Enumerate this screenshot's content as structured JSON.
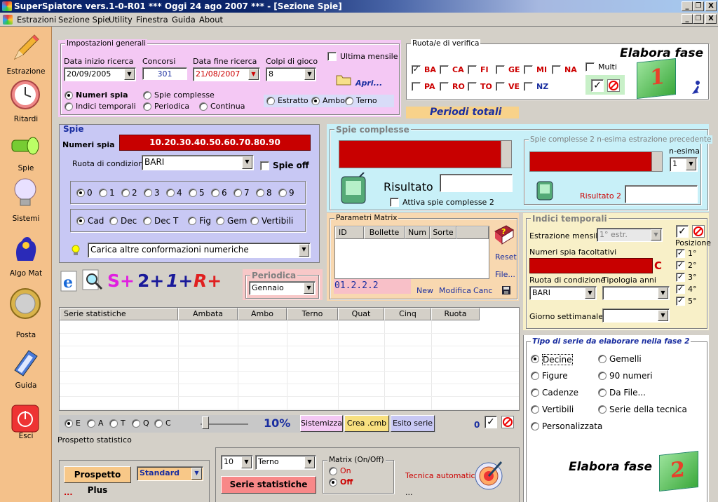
{
  "window": {
    "title": "SuperSpiatore vers.1-0-R01  ***  Oggi 24 ago 2007  ***  - [Sezione Spie]",
    "min": "_",
    "restore": "❐",
    "close": "X"
  },
  "menu": [
    "Estrazioni",
    "Sezione Spie",
    "Utility",
    "Finestra",
    "Guida",
    "About"
  ],
  "sidebar": [
    {
      "label": "Estrazione",
      "icon": "pencil-icon"
    },
    {
      "label": "Ritardi",
      "icon": "clock-icon"
    },
    {
      "label": "Spie",
      "icon": "flashlight-icon"
    },
    {
      "label": "Sistemi",
      "icon": "lightbulb-icon"
    },
    {
      "label": "Algo Mat",
      "icon": "lottery-hand-icon"
    },
    {
      "label": "Posta",
      "icon": "coin-icon"
    },
    {
      "label": "Guida",
      "icon": "book-icon"
    },
    {
      "label": "Esci",
      "icon": "power-icon"
    }
  ],
  "impostazioni": {
    "title": "Impostazioni generali",
    "data_inizio_label": "Data inizio ricerca",
    "data_inizio": "20/09/2005",
    "concorsi_label": "Concorsi",
    "concorsi": "301",
    "data_fine_label": "Data fine ricerca",
    "data_fine": "21/08/2007",
    "colpi_label": "Colpi di gioco",
    "colpi": "8",
    "ultima_mensile": "Ultima mensile",
    "apri": "Apri...",
    "modes": [
      "Numeri spia",
      "Spie complesse",
      "Indici temporali",
      "Periodica",
      "Continua"
    ],
    "sorte": [
      "Estratto",
      "Ambo",
      "Terno"
    ]
  },
  "ruote": {
    "title": "Ruota/e di verifica",
    "row1": [
      "BA",
      "CA",
      "FI",
      "GE",
      "MI",
      "NA"
    ],
    "row2": [
      "PA",
      "RO",
      "TO",
      "VE",
      "NZ"
    ],
    "multi": "Multi",
    "elabora1": "Elabora fase",
    "fase1": "1"
  },
  "periodi_totali": "Periodi totali",
  "spie": {
    "title": "Spie",
    "numeri_label": "Numeri spia",
    "numeri": "10.20.30.40.50.60.70.80.90",
    "ruota_label": "Ruota di condizione",
    "ruota": "BARI",
    "spie_off": "Spie off",
    "digits": [
      "0",
      "1",
      "2",
      "3",
      "4",
      "5",
      "6",
      "7",
      "8",
      "9"
    ],
    "tipi": [
      "Cad",
      "Dec",
      "Dec T",
      "Fig",
      "Gem",
      "Vertibili"
    ],
    "carica": "Carica altre conformazioni numeriche"
  },
  "spie_complesse": {
    "title": "Spie complesse",
    "risultato": "Risultato",
    "attiva": "Attiva spie complesse 2",
    "sub_title": "Spie complesse 2 n-esima estrazione precedente",
    "nesima_label": "n-esima",
    "nesima": "1",
    "risultato2": "Risultato 2"
  },
  "matrix": {
    "title": "Parametri Matrix",
    "columns": [
      "ID",
      "Bollette",
      "Num",
      "Sorte"
    ],
    "value": "01.2.2.2",
    "reset": "Reset",
    "file": "File...",
    "new": "New",
    "modifica": "Modifica",
    "canc": "Canc"
  },
  "indici": {
    "title": "Indici temporali",
    "estr_mensile_label": "Estrazione mensile:",
    "estr_mensile": "1° estr.",
    "numeri_fac": "Numeri spia facoltativi",
    "c": "C",
    "ruota_label": "Ruota di condizione",
    "ruota": "BARI",
    "tipologia": "Tipologia anni",
    "giorno": "Giorno settimanale",
    "posizione": "Posizione",
    "pos": [
      "1°",
      "2°",
      "3°",
      "4°",
      "5°"
    ]
  },
  "tools": {
    "splus": "S+",
    "two": "2+",
    "one": "1+",
    "rplus": "R+"
  },
  "periodica": {
    "title": "Periodica",
    "mese": "Gennaio"
  },
  "table": {
    "columns": [
      "Serie statistiche",
      "Ambata",
      "Ambo",
      "Terno",
      "Quat",
      "Cinq",
      "Ruota"
    ]
  },
  "bottom": {
    "radios": [
      "E",
      "A",
      "T",
      "Q",
      "C"
    ],
    "percent": "10%",
    "sistemizza": "Sistemizza",
    "crea": "Crea .cmb",
    "esito": "Esito serie",
    "zero": "0",
    "prospetto": "Prospetto statistico",
    "prospetto_plus": "Prospetto Plus",
    "standard": "Standard",
    "dots": "...",
    "count": "10",
    "sorte": "Terno",
    "serie": "Serie statistiche",
    "matrix_title": "Matrix (On/Off)",
    "on": "On",
    "off": "Off",
    "tecnica": "Tecnica automatica"
  },
  "tipo_serie": {
    "title": "Tipo di serie da elaborare nella fase 2",
    "col1": [
      "Decine",
      "Figure",
      "Cadenze",
      "Vertibili",
      "Personalizzata"
    ],
    "col2": [
      "Gemelli",
      "90 numeri",
      "Da File...",
      "Serie della tecnica"
    ],
    "elabora2": "Elabora fase",
    "fase2": "2"
  }
}
